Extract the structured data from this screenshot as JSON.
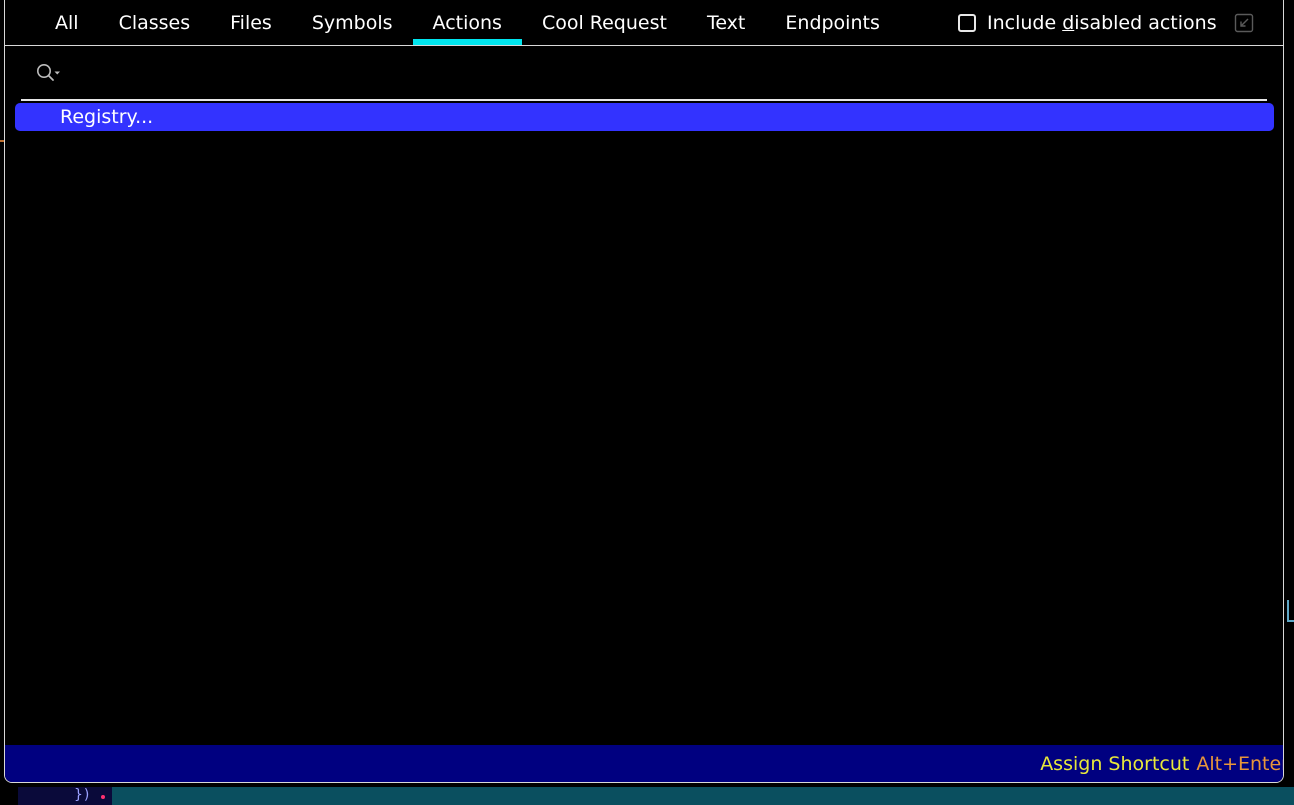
{
  "tabs": [
    {
      "label": "All",
      "active": false
    },
    {
      "label": "Classes",
      "active": false
    },
    {
      "label": "Files",
      "active": false
    },
    {
      "label": "Symbols",
      "active": false
    },
    {
      "label": "Actions",
      "active": true
    },
    {
      "label": "Cool Request",
      "active": false
    },
    {
      "label": "Text",
      "active": false
    },
    {
      "label": "Endpoints",
      "active": false
    }
  ],
  "include_disabled": {
    "label_before": "Include ",
    "label_mnemonic": "d",
    "label_after": "isabled actions",
    "checked": false
  },
  "search": {
    "value": "",
    "placeholder": ""
  },
  "results": [
    {
      "label": "Registry...",
      "selected": true
    }
  ],
  "status": {
    "hint_label": "Assign Shortcut",
    "hint_key": "Alt+Enter"
  },
  "background": {
    "code_fragment": "})"
  },
  "icons": {
    "search": "search-icon",
    "collapse": "collapse-icon",
    "checkbox": "checkbox-icon"
  },
  "colors": {
    "active_tab_underline": "#00e5ee",
    "selection": "#3333ff",
    "status_bar": "#000080",
    "hint_label": "#e8e83a",
    "hint_key": "#e8963a"
  }
}
